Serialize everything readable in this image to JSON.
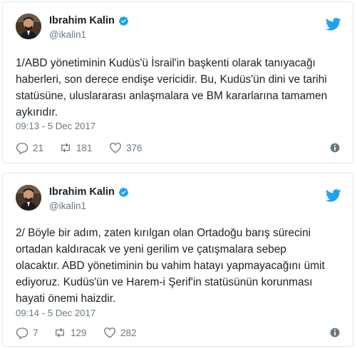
{
  "tweets": [
    {
      "author": "Ibrahim Kalin",
      "handle": "@ikalin1",
      "text": "1/ABD yönetiminin Kudüs'ü İsrail'in başkenti olarak tanıyacağı\nhaberleri, son derece endişe vericidir. Bu, Kudüs'ün dini ve tarihi\nstatüsüne, uluslararası anlaşmalara ve BM kararlarına tamamen\naykırıdır.",
      "timestamp": "09:13 - 5 Dec 2017",
      "replies": "21",
      "retweets": "181",
      "likes": "376"
    },
    {
      "author": "Ibrahim Kalin",
      "handle": "@ikalin1",
      "text": "2/ Böyle bir adım, zaten kırılgan olan Ortadoğu barış sürecini\nortadan kaldıracak ve yeni gerilim ve çatışmalara sebep\nolacaktır. ABD yönetiminin bu vahim hatayı yapmayacağını ümit\nediyoruz. Kudüs'ün ve Harem-i Şerif'in statüsünün korunması\nhayati önemi haizdir.",
      "timestamp": "09:14 - 5 Dec 2017",
      "replies": "7",
      "retweets": "129",
      "likes": "282"
    }
  ],
  "icons": {
    "brand": "twitter-bird-icon",
    "verified": "verified-badge-icon",
    "reply": "reply-icon",
    "retweet": "retweet-icon",
    "like": "heart-icon",
    "info": "info-icon"
  },
  "colors": {
    "twitter_blue": "#1da1f2",
    "border": "#e1e8ed",
    "muted": "#697882",
    "text": "#1c2022"
  }
}
